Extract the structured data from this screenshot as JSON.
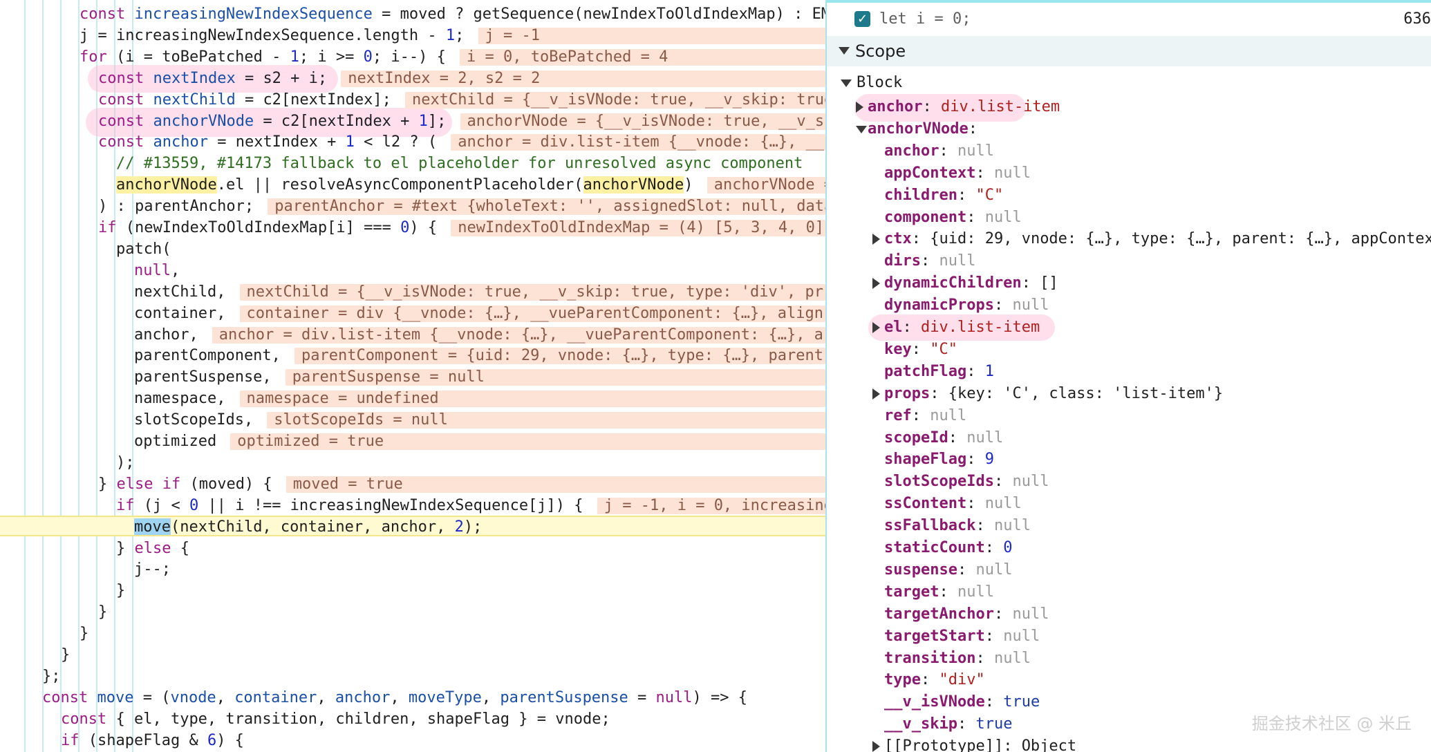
{
  "editor": {
    "lines": [
      {
        "parts": [
          {
            "t": "const ",
            "c": "kw"
          },
          {
            "t": "increasingNewIndexSequence",
            "c": "var"
          },
          {
            "t": " = moved ? getSequence(newIndexToOldIndexMap) : EM",
            "c": ""
          }
        ]
      },
      {
        "parts": [
          {
            "t": "j = increasingNewIndexSequence.length - ",
            "c": ""
          },
          {
            "t": "1",
            "c": "num"
          },
          {
            "t": ";",
            "c": ""
          }
        ],
        "value": "j = -1"
      },
      {
        "parts": [
          {
            "t": "for",
            "c": "kw"
          },
          {
            "t": " (i = toBePatched - ",
            "c": ""
          },
          {
            "t": "1",
            "c": "num"
          },
          {
            "t": "; i >= ",
            "c": ""
          },
          {
            "t": "0",
            "c": "num"
          },
          {
            "t": "; i--) {",
            "c": ""
          }
        ],
        "value": "i = 0, toBePatched = 4"
      },
      {
        "parts": [
          {
            "t": "const ",
            "c": "kw"
          },
          {
            "t": "nextIndex",
            "c": "var"
          },
          {
            "t": " = s2 + i;",
            "c": ""
          }
        ],
        "value": "nextIndex = 2, s2 = 2"
      },
      {
        "parts": [
          {
            "t": "const ",
            "c": "kw"
          },
          {
            "t": "nextChild",
            "c": "var"
          },
          {
            "t": " = c2[nextIndex];",
            "c": ""
          }
        ],
        "value": "nextChild = {__v_isVNode: true, __v_skip: true"
      },
      {
        "parts": [
          {
            "t": "const ",
            "c": "kw"
          },
          {
            "t": "anchorVNode",
            "c": "var"
          },
          {
            "t": " = c2[nextIndex + ",
            "c": ""
          },
          {
            "t": "1",
            "c": "num"
          },
          {
            "t": "];",
            "c": ""
          }
        ],
        "value": "anchorVNode = {__v_isVNode: true, __v_s"
      },
      {
        "parts": [
          {
            "t": "const ",
            "c": "kw"
          },
          {
            "t": "anchor",
            "c": "var"
          },
          {
            "t": " = nextIndex + ",
            "c": ""
          },
          {
            "t": "1",
            "c": "num"
          },
          {
            "t": " < l2 ? (",
            "c": ""
          }
        ],
        "value": "anchor = div.list-item {__vnode: {…}, __"
      },
      {
        "parts": [
          {
            "t": "// #13559, #14173 fallback to el placeholder for unresolved async component",
            "c": "cmt"
          }
        ]
      },
      {
        "parts": [
          {
            "t": "anchorVNode",
            "c": "hl-word"
          },
          {
            "t": ".el || resolveAsyncComponentPlaceholder(",
            "c": ""
          },
          {
            "t": "anchorVNode",
            "c": "hl-word"
          },
          {
            "t": ")",
            "c": ""
          }
        ],
        "value": "anchorVNode ="
      },
      {
        "parts": [
          {
            "t": ") : parentAnchor;",
            "c": ""
          }
        ],
        "value": "parentAnchor = #text {wholeText: '', assignedSlot: null, data"
      },
      {
        "parts": [
          {
            "t": "if",
            "c": "kw"
          },
          {
            "t": " (newIndexToOldIndexMap[i] === ",
            "c": ""
          },
          {
            "t": "0",
            "c": "num"
          },
          {
            "t": ") {",
            "c": ""
          }
        ],
        "value": "newIndexToOldIndexMap = (4) [5, 3, 4, 0]"
      },
      {
        "parts": [
          {
            "t": "patch(",
            "c": ""
          }
        ]
      },
      {
        "parts": [
          {
            "t": "null",
            "c": "kw"
          },
          {
            "t": ",",
            "c": ""
          }
        ]
      },
      {
        "parts": [
          {
            "t": "nextChild,",
            "c": ""
          }
        ],
        "value": "nextChild = {__v_isVNode: true, __v_skip: true, type: 'div', pr"
      },
      {
        "parts": [
          {
            "t": "container,",
            "c": ""
          }
        ],
        "value": "container = div {__vnode: {…}, __vueParentComponent: {…}, align"
      },
      {
        "parts": [
          {
            "t": "anchor,",
            "c": ""
          }
        ],
        "value": "anchor = div.list-item {__vnode: {…}, __vueParentComponent: {…}, a"
      },
      {
        "parts": [
          {
            "t": "parentComponent,",
            "c": ""
          }
        ],
        "value": "parentComponent = {uid: 29, vnode: {…}, type: {…}, parent"
      },
      {
        "parts": [
          {
            "t": "parentSuspense,",
            "c": ""
          }
        ],
        "value": "parentSuspense = null"
      },
      {
        "parts": [
          {
            "t": "namespace,",
            "c": ""
          }
        ],
        "value": "namespace = undefined"
      },
      {
        "parts": [
          {
            "t": "slotScopeIds,",
            "c": ""
          }
        ],
        "value": "slotScopeIds = null"
      },
      {
        "parts": [
          {
            "t": "optimized",
            "c": ""
          }
        ],
        "value": "optimized = true"
      },
      {
        "parts": [
          {
            "t": ");",
            "c": ""
          }
        ]
      },
      {
        "parts": [
          {
            "t": "} ",
            "c": ""
          },
          {
            "t": "else if",
            "c": "kw"
          },
          {
            "t": " (moved) {",
            "c": ""
          }
        ],
        "value": "moved = true"
      },
      {
        "parts": [
          {
            "t": "if",
            "c": "kw"
          },
          {
            "t": " (j < ",
            "c": ""
          },
          {
            "t": "0",
            "c": "num"
          },
          {
            "t": " || i !== increasingNewIndexSequence[j]) {",
            "c": ""
          }
        ],
        "value": "j = -1, i = 0, increasing"
      },
      {
        "parts": [
          {
            "t": "move",
            "c": "hl-sel"
          },
          {
            "t": "(nextChild, container, anchor, ",
            "c": ""
          },
          {
            "t": "2",
            "c": "num"
          },
          {
            "t": ");",
            "c": ""
          }
        ]
      },
      {
        "parts": [
          {
            "t": "} ",
            "c": ""
          },
          {
            "t": "else",
            "c": "kw"
          },
          {
            "t": " {",
            "c": ""
          }
        ]
      },
      {
        "parts": [
          {
            "t": "j--;",
            "c": ""
          }
        ]
      },
      {
        "parts": [
          {
            "t": "}",
            "c": ""
          }
        ]
      },
      {
        "parts": [
          {
            "t": "}",
            "c": ""
          }
        ]
      },
      {
        "parts": [
          {
            "t": "}",
            "c": ""
          }
        ]
      },
      {
        "parts": [
          {
            "t": "}",
            "c": ""
          }
        ]
      },
      {
        "parts": [
          {
            "t": "};",
            "c": ""
          }
        ]
      },
      {
        "parts": [
          {
            "t": "const ",
            "c": "kw"
          },
          {
            "t": "move",
            "c": "var"
          },
          {
            "t": " = (",
            "c": ""
          },
          {
            "t": "vnode",
            "c": "var"
          },
          {
            "t": ", ",
            "c": ""
          },
          {
            "t": "container",
            "c": "var"
          },
          {
            "t": ", ",
            "c": ""
          },
          {
            "t": "anchor",
            "c": "var"
          },
          {
            "t": ", ",
            "c": ""
          },
          {
            "t": "moveType",
            "c": "var"
          },
          {
            "t": ", ",
            "c": ""
          },
          {
            "t": "parentSuspense",
            "c": "var"
          },
          {
            "t": " = ",
            "c": ""
          },
          {
            "t": "null",
            "c": "kw"
          },
          {
            "t": ") => {",
            "c": ""
          }
        ]
      },
      {
        "parts": [
          {
            "t": "const",
            "c": "kw"
          },
          {
            "t": " { el, type, transition, children, shapeFlag } = vnode;",
            "c": ""
          }
        ]
      },
      {
        "parts": [
          {
            "t": "if",
            "c": "kw"
          },
          {
            "t": " (shapeFlag & ",
            "c": ""
          },
          {
            "t": "6",
            "c": "num"
          },
          {
            "t": ") {",
            "c": ""
          }
        ]
      }
    ]
  },
  "scope": {
    "watch": {
      "expression": "let i = 0;",
      "value": "636"
    },
    "header": "Scope",
    "block_label": "Block",
    "rows": [
      {
        "key": "anchor",
        "value": "div.list-item",
        "vc": "pstr",
        "expandable": true,
        "indent": 0,
        "keyc": "pkey"
      },
      {
        "key": "anchorVNode",
        "value": "",
        "vc": "pobj",
        "expandable": true,
        "expanded": true,
        "indent": 0,
        "keyc": "pkey"
      },
      {
        "key": "anchor",
        "value": "null",
        "vc": "pnull",
        "indent": 1
      },
      {
        "key": "appContext",
        "value": "null",
        "vc": "pnull",
        "indent": 1
      },
      {
        "key": "children",
        "value": "\"C\"",
        "vc": "pstr",
        "indent": 1
      },
      {
        "key": "component",
        "value": "null",
        "vc": "pnull",
        "indent": 1
      },
      {
        "key": "ctx",
        "value": "{uid: 29, vnode: {…}, type: {…}, parent: {…}, appContex",
        "vc": "pobj",
        "expandable": true,
        "indent": 1
      },
      {
        "key": "dirs",
        "value": "null",
        "vc": "pnull",
        "indent": 1
      },
      {
        "key": "dynamicChildren",
        "value": "[]",
        "vc": "pobj",
        "expandable": true,
        "indent": 1
      },
      {
        "key": "dynamicProps",
        "value": "null",
        "vc": "pnull",
        "indent": 1
      },
      {
        "key": "el",
        "value": "div.list-item",
        "vc": "pstr",
        "expandable": true,
        "indent": 1
      },
      {
        "key": "key",
        "value": "\"C\"",
        "vc": "pstr",
        "indent": 1
      },
      {
        "key": "patchFlag",
        "value": "1",
        "vc": "pnum",
        "indent": 1
      },
      {
        "key": "props",
        "value": "{key: 'C', class: 'list-item'}",
        "vc": "pobj",
        "expandable": true,
        "indent": 1
      },
      {
        "key": "ref",
        "value": "null",
        "vc": "pnull",
        "indent": 1
      },
      {
        "key": "scopeId",
        "value": "null",
        "vc": "pnull",
        "indent": 1
      },
      {
        "key": "shapeFlag",
        "value": "9",
        "vc": "pnum",
        "indent": 1
      },
      {
        "key": "slotScopeIds",
        "value": "null",
        "vc": "pnull",
        "indent": 1
      },
      {
        "key": "ssContent",
        "value": "null",
        "vc": "pnull",
        "indent": 1
      },
      {
        "key": "ssFallback",
        "value": "null",
        "vc": "pnull",
        "indent": 1
      },
      {
        "key": "staticCount",
        "value": "0",
        "vc": "pnum",
        "indent": 1
      },
      {
        "key": "suspense",
        "value": "null",
        "vc": "pnull",
        "indent": 1
      },
      {
        "key": "target",
        "value": "null",
        "vc": "pnull",
        "indent": 1
      },
      {
        "key": "targetAnchor",
        "value": "null",
        "vc": "pnull",
        "indent": 1
      },
      {
        "key": "targetStart",
        "value": "null",
        "vc": "pnull",
        "indent": 1
      },
      {
        "key": "transition",
        "value": "null",
        "vc": "pnull",
        "indent": 1
      },
      {
        "key": "type",
        "value": "\"div\"",
        "vc": "pstr",
        "indent": 1
      },
      {
        "key": "__v_isVNode",
        "value": "true",
        "vc": "pbool",
        "indent": 1
      },
      {
        "key": "__v_skip",
        "value": "true",
        "vc": "pbool",
        "indent": 1
      },
      {
        "key": "[[Prototype]]",
        "value": "Object",
        "vc": "pobj",
        "expandable": true,
        "indent": 1,
        "keyc": "pkeyplain"
      }
    ]
  },
  "watermark": "掘金技术社区 @ 米丘",
  "colors": {
    "keyword": "#9d1c86",
    "inline_value_bg": "#fde3d6",
    "active_line_bg": "#fffad1",
    "annotation": "#fcb9d2"
  }
}
